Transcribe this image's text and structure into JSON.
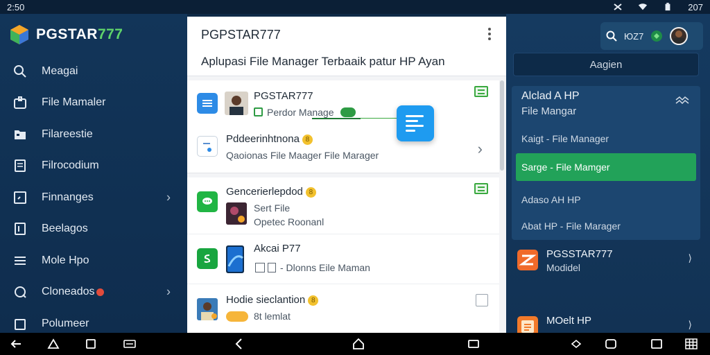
{
  "statusbar": {
    "time": "2:50",
    "battery": "207"
  },
  "brand": {
    "name_main": "PGSTAR",
    "name_accent": "777"
  },
  "sidebar": {
    "items": [
      {
        "label": "Meagai",
        "icon": "search-icon"
      },
      {
        "label": "File Mamaler",
        "icon": "lock-folder-icon"
      },
      {
        "label": "Filareestie",
        "icon": "folder-icon"
      },
      {
        "label": "Filrocodium",
        "icon": "document-icon"
      },
      {
        "label": "Finnanges",
        "icon": "frame-icon",
        "chevron": true
      },
      {
        "label": "Beelagos",
        "icon": "note-icon"
      },
      {
        "label": "Mole Hpo",
        "icon": "menu-icon"
      },
      {
        "label": "Cloneados",
        "icon": "refresh-icon",
        "chevron": true,
        "badge": true
      },
      {
        "label": "Polumeer",
        "icon": "archive-icon"
      }
    ]
  },
  "main": {
    "title": "PGPSTAR777",
    "subtitle": "Aplupasi File Manager Terbaaik patur HP Ayan",
    "card1": {
      "row1": {
        "title": "PGSTAR777",
        "sub": "Perdor Manage"
      },
      "row2": {
        "title": "Pddeerinhtnona",
        "sub": "Qaoionas File Maager  File Marager"
      }
    },
    "card2": {
      "row1": {
        "title": "Gencerierlepdod",
        "sub1": "Sert File",
        "sub2": "Opetec Roonanl"
      },
      "row2": {
        "title": "Akcai P77",
        "sub": "- Dlonns Eile Maman"
      },
      "row3": {
        "title": "Hodie sieclantion",
        "sub": "8t lemlat"
      }
    },
    "coin_label": "8"
  },
  "right": {
    "topbar_text": "ЮZ7",
    "segment_label": "Aagien",
    "card": {
      "head1": "Alclad A HP",
      "head2": "File Mangar",
      "item1": "Kaigt - File Manager",
      "active": "Sarge - File Mamger",
      "item2": "Adaso AH HP",
      "item3": "Abat HP - File Marager"
    },
    "apps": [
      {
        "title": "PGSSTAR777",
        "sub": "Modidel"
      },
      {
        "title": "MOelt HP",
        "sub": ""
      }
    ]
  }
}
